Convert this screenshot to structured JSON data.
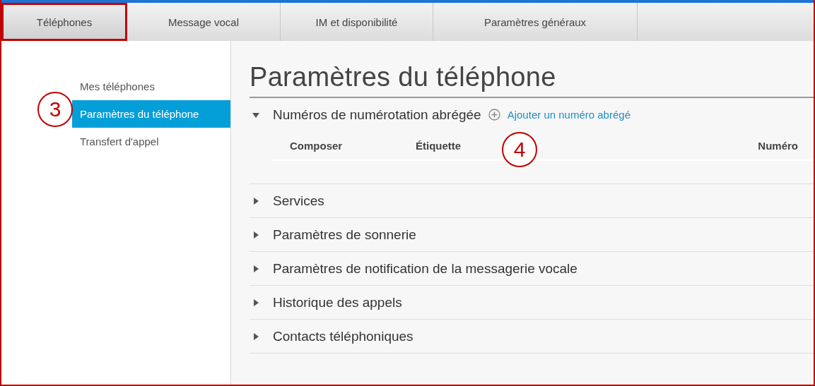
{
  "tabs": [
    {
      "label": "Téléphones",
      "selected": true,
      "highlighted": true
    },
    {
      "label": "Message vocal",
      "selected": false,
      "highlighted": false
    },
    {
      "label": "IM et disponibilité",
      "selected": false,
      "highlighted": false
    },
    {
      "label": "Paramètres généraux",
      "selected": false,
      "highlighted": false
    }
  ],
  "sidebar": {
    "items": [
      {
        "label": "Mes téléphones",
        "selected": false
      },
      {
        "label": "Paramètres du téléphone",
        "selected": true
      },
      {
        "label": "Transfert d'appel",
        "selected": false
      }
    ]
  },
  "page_title": "Paramètres du téléphone",
  "sections": [
    {
      "title": "Numéros de numérotation abrégée",
      "expanded": true,
      "add_link": "Ajouter un numéro abrégé",
      "table": {
        "columns": [
          "Composer",
          "Étiquette",
          "Numéro"
        ]
      }
    },
    {
      "title": "Services",
      "expanded": false
    },
    {
      "title": "Paramètres de sonnerie",
      "expanded": false
    },
    {
      "title": "Paramètres de notification de la messagerie vocale",
      "expanded": false
    },
    {
      "title": "Historique des appels",
      "expanded": false
    },
    {
      "title": "Contacts téléphoniques",
      "expanded": false
    }
  ],
  "callouts": [
    {
      "label": "3"
    },
    {
      "label": "4"
    }
  ]
}
